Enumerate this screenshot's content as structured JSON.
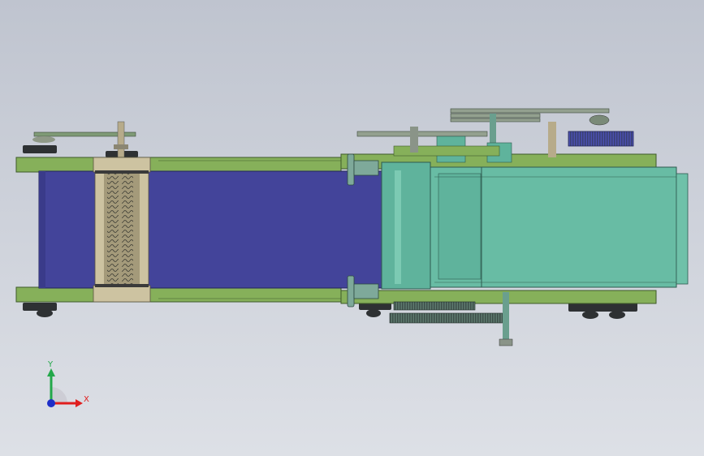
{
  "viewport": {
    "colors": {
      "background_top": "#bfc4cf",
      "background_bottom": "#dde0e6",
      "frame_green": "#86b05a",
      "belt_blue": "#43449a",
      "roller_tan": "#cdc3a1",
      "housing_teal": "#5fb39c",
      "dark_part": "#2f3a3a"
    }
  },
  "triad": {
    "x_label": "X",
    "y_label": "Y",
    "x_color": "#e01e1e",
    "y_color": "#23a84a",
    "z_color": "#1e2ec8"
  }
}
